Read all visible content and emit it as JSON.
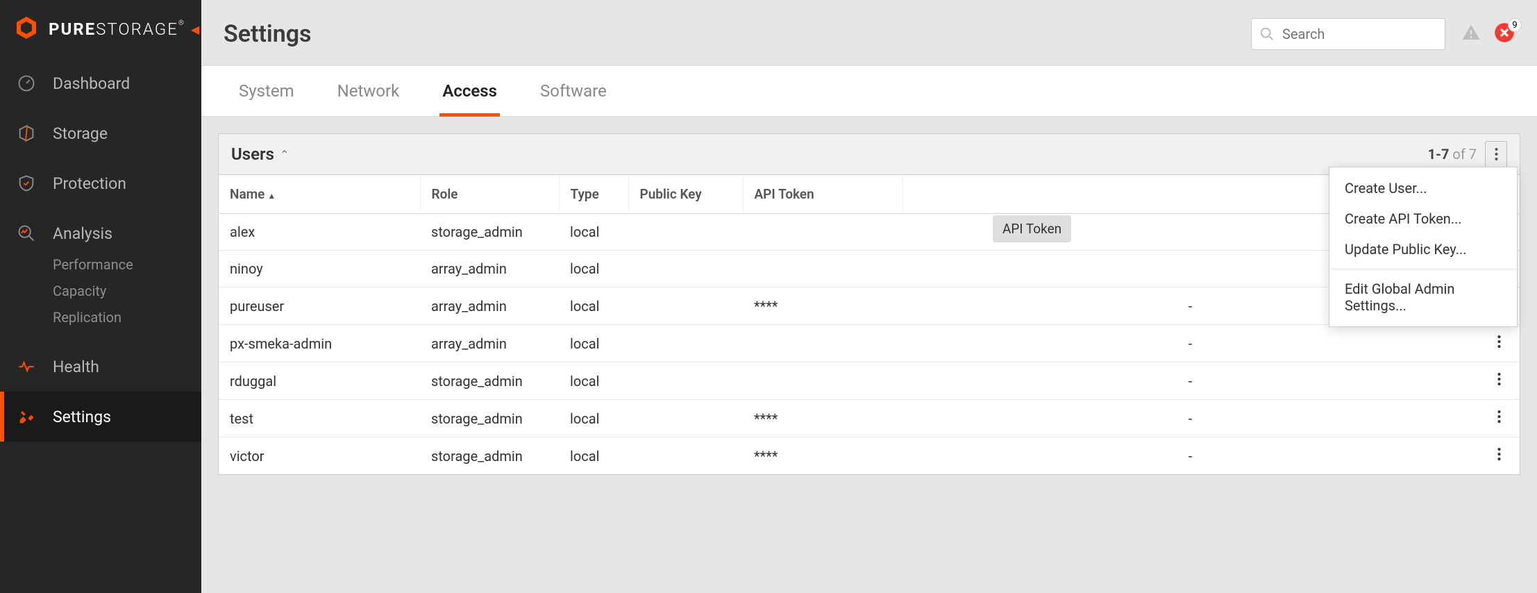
{
  "brand": {
    "word1": "PURE",
    "word2": "STORAGE",
    "reg": "®"
  },
  "nav": {
    "dashboard": "Dashboard",
    "storage": "Storage",
    "protection": "Protection",
    "analysis": "Analysis",
    "analysis_sub": {
      "performance": "Performance",
      "capacity": "Capacity",
      "replication": "Replication"
    },
    "health": "Health",
    "settings": "Settings"
  },
  "page_title": "Settings",
  "search_placeholder": "Search",
  "alert_badge": "9",
  "tabs": {
    "system": "System",
    "network": "Network",
    "access": "Access",
    "software": "Software"
  },
  "panel": {
    "title": "Users",
    "page_range": "1-7",
    "page_of": " of 7"
  },
  "columns": {
    "name": "Name",
    "role": "Role",
    "type": "Type",
    "pk": "Public Key",
    "api": "API Token"
  },
  "rows": [
    {
      "name": "alex",
      "role": "storage_admin",
      "type": "local",
      "pk": "",
      "api": "",
      "dash": ""
    },
    {
      "name": "ninoy",
      "role": "array_admin",
      "type": "local",
      "pk": "",
      "api": "",
      "dash": ""
    },
    {
      "name": "pureuser",
      "role": "array_admin",
      "type": "local",
      "pk": "",
      "api": "****",
      "dash": "-"
    },
    {
      "name": "px-smeka-admin",
      "role": "array_admin",
      "type": "local",
      "pk": "",
      "api": "",
      "dash": "-"
    },
    {
      "name": "rduggal",
      "role": "storage_admin",
      "type": "local",
      "pk": "",
      "api": "",
      "dash": "-"
    },
    {
      "name": "test",
      "role": "storage_admin",
      "type": "local",
      "pk": "",
      "api": "****",
      "dash": "-"
    },
    {
      "name": "victor",
      "role": "storage_admin",
      "type": "local",
      "pk": "",
      "api": "****",
      "dash": "-"
    }
  ],
  "tooltip": "API Token",
  "menu": {
    "create_user": "Create User...",
    "create_api": "Create API Token...",
    "update_pk": "Update Public Key...",
    "edit_global": "Edit Global Admin Settings..."
  }
}
